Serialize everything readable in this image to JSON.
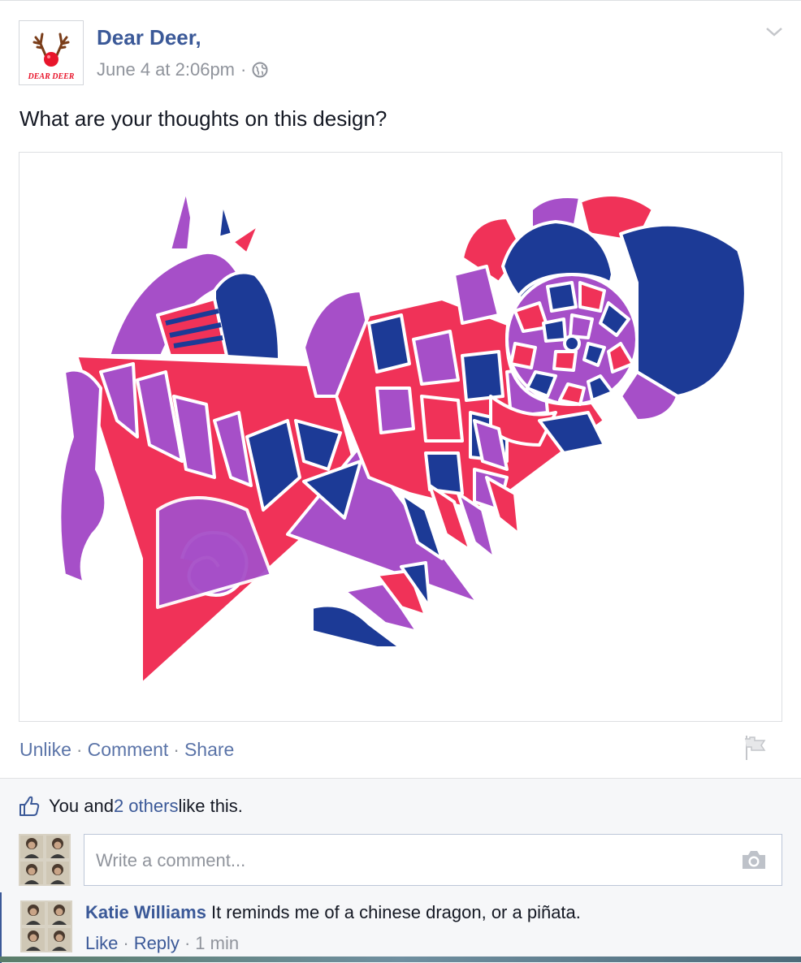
{
  "post": {
    "page_name": "Dear Deer,",
    "logo_text": "DEAR DEER",
    "timestamp": "June 4 at 2:06pm",
    "separator": "·",
    "text": "What are your thoughts on this design?"
  },
  "actions": {
    "unlike": "Unlike",
    "comment": "Comment",
    "share": "Share",
    "dot": "·"
  },
  "likes": {
    "prefix": "You and ",
    "link": "2 others",
    "suffix": " like this."
  },
  "comment_input": {
    "placeholder": "Write a comment..."
  },
  "comments": [
    {
      "author": "Katie Williams",
      "text": "It reminds me of a chinese dragon, or a piñata.",
      "like": "Like",
      "reply": "Reply",
      "time": "1 min"
    }
  ],
  "colors": {
    "link_blue": "#3b5998",
    "artwork_red": "#f03258",
    "artwork_purple": "#a64fc8",
    "artwork_navy": "#1c3a96"
  },
  "icons": [
    "chevron-down-icon",
    "globe-icon",
    "flag-icon",
    "thumbs-up-icon",
    "camera-icon"
  ]
}
